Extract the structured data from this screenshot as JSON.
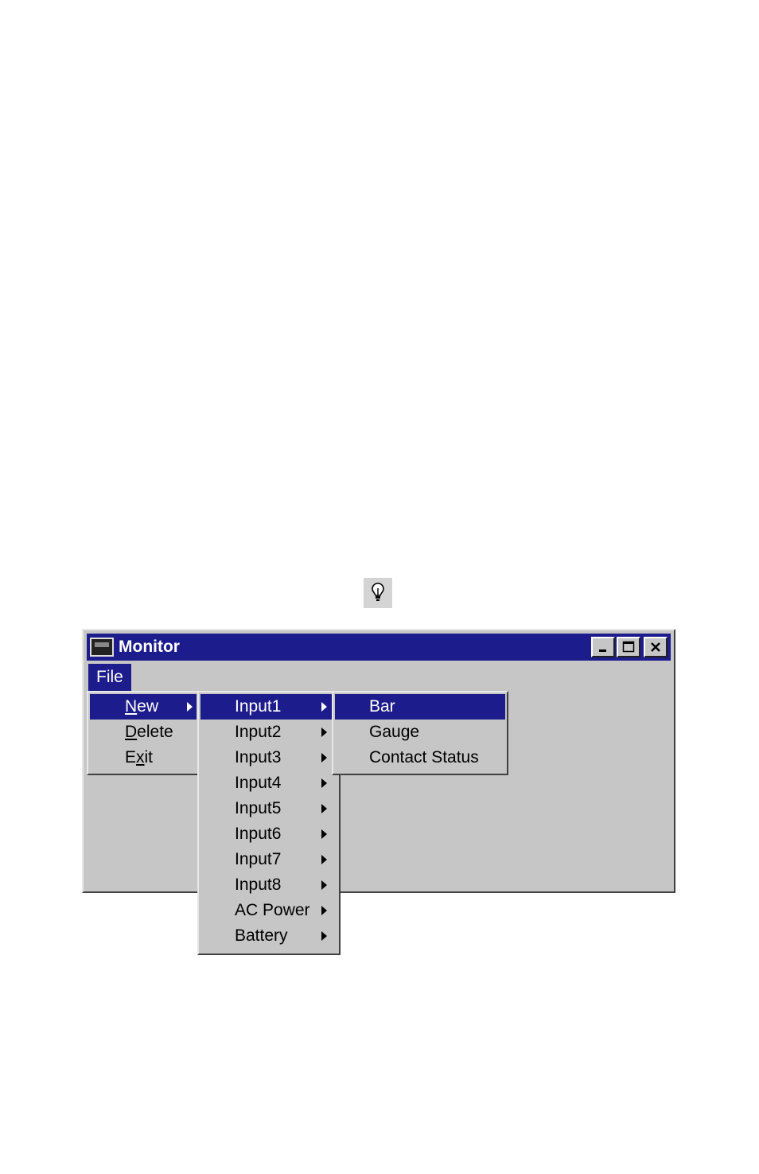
{
  "window": {
    "title": "Monitor",
    "minimize_label": "_",
    "maximize_label": "□",
    "close_label": "✕"
  },
  "menubar": {
    "file": "File"
  },
  "file_menu": {
    "new": {
      "pre": "",
      "acc": "N",
      "post": "ew"
    },
    "delete": {
      "pre": "",
      "acc": "D",
      "post": "elete"
    },
    "exit": {
      "pre": "E",
      "acc": "x",
      "post": "it"
    }
  },
  "inputs_menu": [
    "Input1",
    "Input2",
    "Input3",
    "Input4",
    "Input5",
    "Input6",
    "Input7",
    "Input8",
    "AC Power",
    "Battery"
  ],
  "display_menu": [
    "Bar",
    "Gauge",
    "Contact Status"
  ],
  "colors": {
    "highlight": "#1c1c8c",
    "face": "#c6c6c6"
  },
  "icons": {
    "tip": "lightbulb-icon",
    "app": "monitor-app-icon"
  }
}
